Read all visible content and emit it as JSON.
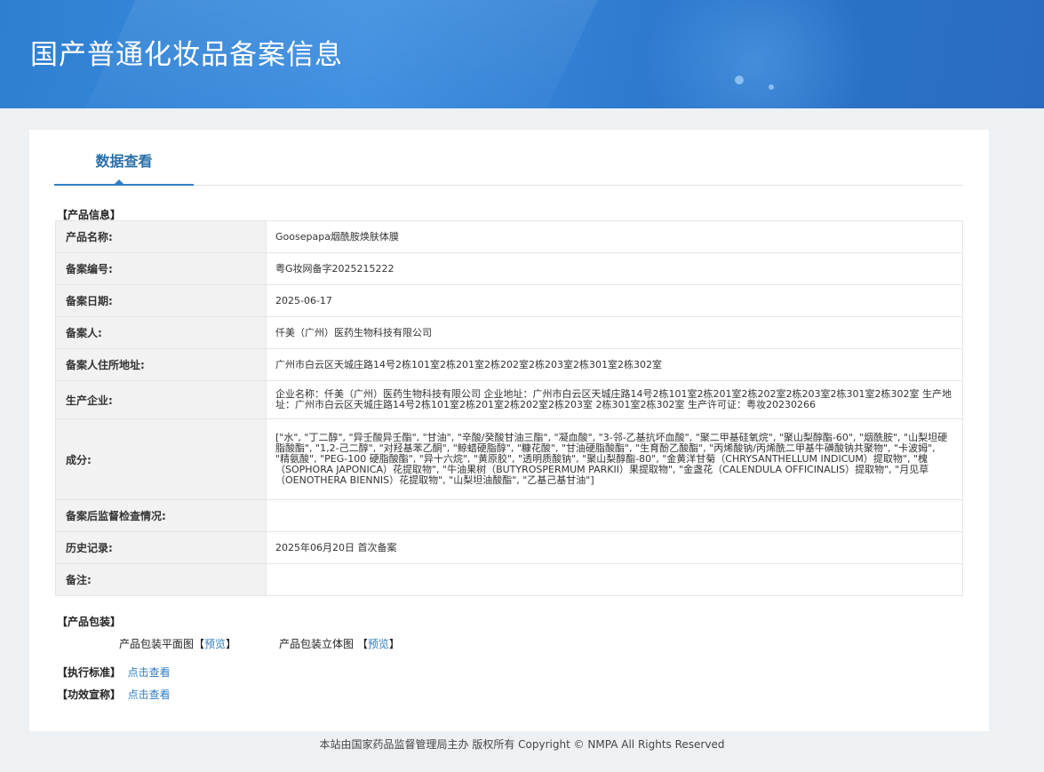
{
  "header": {
    "title": "国产普通化妆品备案信息"
  },
  "tabs": [
    {
      "label": "数据查看"
    }
  ],
  "product_info": {
    "section_title": "【产品信息】",
    "rows": [
      {
        "key": "产品名称:",
        "value": "Goosepapa烟酰胺焕肤体膜"
      },
      {
        "key": "备案编号:",
        "value": "粤G妆网备字2025215222"
      },
      {
        "key": "备案日期:",
        "value": "2025-06-17"
      },
      {
        "key": "备案人:",
        "value": "仟美（广州）医药生物科技有限公司"
      },
      {
        "key": "备案人住所地址:",
        "value": "广州市白云区天城庄路14号2栋101室2栋201室2栋202室2栋203室2栋301室2栋302室"
      },
      {
        "key": "生产企业:",
        "value": "企业名称：仟美（广州）医药生物科技有限公司 企业地址：广州市白云区天城庄路14号2栋101室2栋201室2栋202室2栋203室2栋301室2栋302室 生产地址：广州市白云区天城庄路14号2栋101室2栋201室2栋202室2栋203室 2栋301室2栋302室 生产许可证：粤妆20230266"
      },
      {
        "key": "成分:",
        "value": "[\"水\", \"丁二醇\", \"异壬酸异壬酯\", \"甘油\", \"辛酸/癸酸甘油三酯\", \"凝血酸\", \"3-邻-乙基抗坏血酸\", \"聚二甲基硅氧烷\", \"聚山梨醇酯-60\", \"烟酰胺\", \"山梨坦硬脂酸酯\", \"1,2-己二醇\", \"对羟基苯乙酮\", \"鲸蜡硬脂醇\", \"糠花酸\", \"甘油硬脂酸酯\", \"生育酚乙酸酯\", \"丙烯酸钠/丙烯酰二甲基牛磺酸钠共聚物\", \"卡波姆\", \"精氨酸\", \"PEG-100 硬脂酸酯\", \"异十六烷\", \"黄原胶\", \"透明质酸钠\", \"聚山梨醇酯-80\", \"金黄洋甘菊（CHRYSANTHELLUM INDICUM）提取物\", \"槐（SOPHORA JAPONICA）花提取物\", \"牛油果树（BUTYROSPERMUM PARKII）果提取物\", \"金盏花（CALENDULA OFFICINALIS）提取物\", \"月见草（OENOTHERA BIENNIS）花提取物\", \"山梨坦油酸酯\", \"乙基己基甘油\"]"
      },
      {
        "key": "备案后监督检查情况:",
        "value": ""
      },
      {
        "key": "历史记录:",
        "value": "2025年06月20日 首次备案"
      },
      {
        "key": "备注:",
        "value": ""
      }
    ]
  },
  "packaging": {
    "section_title": "【产品包装】",
    "flat_label": "产品包装平面图",
    "solid_label": "产品包装立体图",
    "bracket_open": "【",
    "bracket_close": "】",
    "preview_label": "预览"
  },
  "standard": {
    "label": "【执行标准】",
    "link": "点击查看"
  },
  "claims": {
    "label": "【功效宣称】",
    "link": "点击查看"
  },
  "footer": {
    "text": "本站由国家药品监督管理局主办 版权所有 Copyright © NMPA All Rights Reserved"
  }
}
